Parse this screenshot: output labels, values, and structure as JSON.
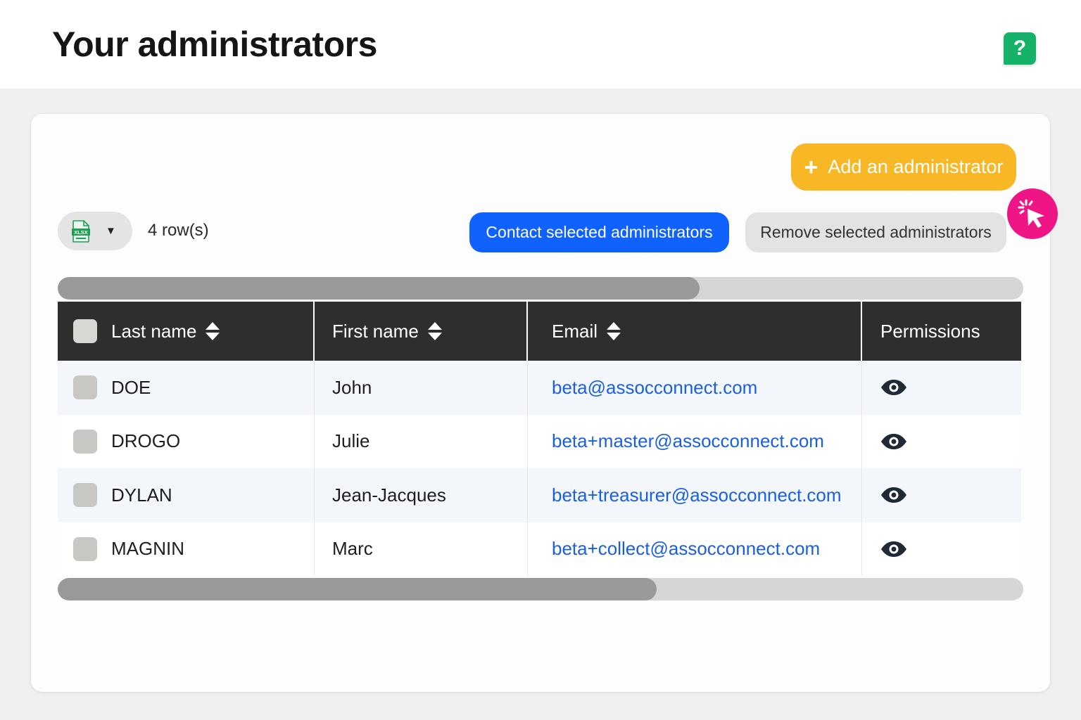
{
  "header": {
    "title": "Your administrators",
    "help_label": "?"
  },
  "toolbar": {
    "add_plus": "+",
    "add_label": "Add an administrator",
    "export_icon": "xlsx-file-icon",
    "export_icon_text": "XLSX",
    "export_caret": "▼",
    "row_count": "4 row(s)",
    "contact_label": "Contact selected administrators",
    "remove_label": "Remove selected administrators"
  },
  "table": {
    "columns": [
      "Last name",
      "First name",
      "Email",
      "Permissions"
    ],
    "rows": [
      {
        "last_name": "DOE",
        "first_name": "John",
        "email": "beta@assocconnect.com"
      },
      {
        "last_name": "DROGO",
        "first_name": "Julie",
        "email": "beta+master@assocconnect.com"
      },
      {
        "last_name": "DYLAN",
        "first_name": "Jean-Jacques",
        "email": "beta+treasurer@assocconnect.com"
      },
      {
        "last_name": "MAGNIN",
        "first_name": "Marc",
        "email": "beta+collect@assocconnect.com"
      }
    ]
  },
  "scrollbars": {
    "top_thumb_fraction": 0.665,
    "bottom_thumb_fraction": 0.62
  },
  "colors": {
    "accent_add": "#f8b725",
    "accent_contact": "#0f62fe",
    "help": "#17b26a",
    "cursor_badge": "#f01587",
    "email_link": "#1a5fe0",
    "table_header": "#2e2e2e"
  }
}
